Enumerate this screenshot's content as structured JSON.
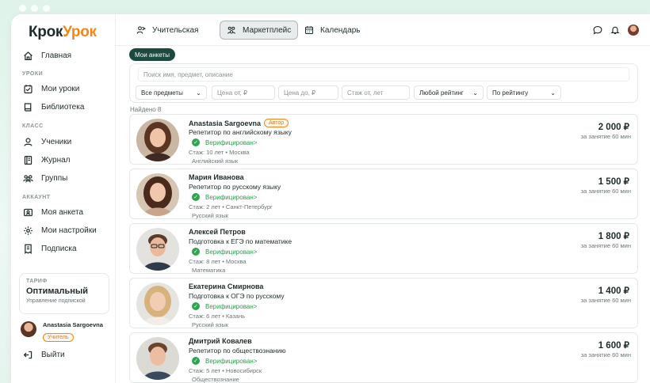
{
  "brand": {
    "part1": "Крок",
    "part2": "Урок"
  },
  "sidebar": {
    "main": "Главная",
    "sections": [
      {
        "title": "УРОКИ",
        "items": [
          "Мои уроки",
          "Библиотека"
        ]
      },
      {
        "title": "КЛАСС",
        "items": [
          "Ученики",
          "Журнал",
          "Группы"
        ]
      },
      {
        "title": "АККАУНТ",
        "items": [
          "Моя анкета",
          "Мои настройки",
          "Подписка"
        ]
      }
    ],
    "tariff": {
      "label": "ТАРИФ",
      "name": "Оптимальный",
      "manage": "Управление подпиской"
    },
    "user": {
      "name": "Anastasia Sargoevna",
      "role": "Учитель"
    },
    "logout": "Выйти"
  },
  "topbar": {
    "tabs": [
      {
        "label": "Учительская",
        "icon": "teacher-icon"
      },
      {
        "label": "Маркетплейс",
        "icon": "marketplace-icon",
        "active": true
      },
      {
        "label": "Календарь",
        "icon": "calendar-icon"
      }
    ]
  },
  "main": {
    "my_profiles": "Мои анкеты",
    "search_placeholder": "Поиск имя, предмет, описание",
    "filters": {
      "subjects": "Все предметы",
      "price_from": "Цена от, ₽",
      "price_to": "Цена до, ₽",
      "experience_from": "Стаж от, лет",
      "rating": "Любой рейтинг",
      "sort": "По рейтингу"
    },
    "found": "Найдено 8",
    "verified_label": "Верифицирован",
    "per_label": "за занятие 60 мин",
    "cards": [
      {
        "name": "Anastasia Sargoevna",
        "badge": "Автор",
        "subject": "Репетитор по английскому языку",
        "exp": "Стаж: 10 лет • Москва",
        "lang": "Английский язык",
        "price": "2 000 ₽"
      },
      {
        "name": "Мария Иванова",
        "subject": "Репетитор по русскому языку",
        "exp": "Стаж: 2 лет • Санкт-Петербург",
        "lang": "Русский язык",
        "price": "1 500 ₽"
      },
      {
        "name": "Алексей Петров",
        "subject": "Подготовка к ЕГЭ по математике",
        "exp": "Стаж: 8 лет • Москва",
        "lang": "Математика",
        "price": "1 800 ₽"
      },
      {
        "name": "Екатерина Смирнова",
        "subject": "Подготовка к ОГЭ по русскому",
        "exp": "Стаж: 6 лет • Казань",
        "lang": "Русский язык",
        "price": "1 400 ₽"
      },
      {
        "name": "Дмитрий Ковалев",
        "subject": "Репетитор по обществознанию",
        "exp": "Стаж: 5 лет • Новосибирск",
        "lang": "Обществознание",
        "price": "1 600 ₽"
      }
    ]
  }
}
